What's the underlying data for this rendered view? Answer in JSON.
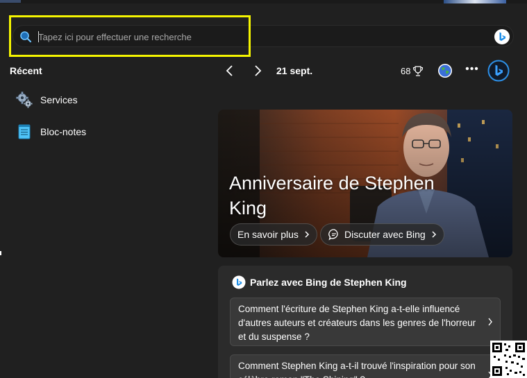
{
  "search": {
    "placeholder": "Tapez ici pour effectuer une recherche"
  },
  "recent": {
    "title": "Récent",
    "items": [
      {
        "label": "Services",
        "icon": "gear-icon"
      },
      {
        "label": "Bloc-notes",
        "icon": "notepad-icon"
      }
    ]
  },
  "header": {
    "date": "21 sept.",
    "points": "68"
  },
  "hero": {
    "title": "Anniversaire de Stephen King",
    "learn_more": "En savoir plus",
    "chat_bing": "Discuter avec Bing"
  },
  "bing_card": {
    "title": "Parlez avec Bing de Stephen King",
    "questions": [
      "Comment l'écriture de Stephen King a-t-elle influencé d'autres auteurs et créateurs dans les genres de l'horreur et du suspense ?",
      "Comment Stephen King a-t-il trouvé l'inspiration pour son célèbre roman \"The Shining\" ?"
    ]
  },
  "colors": {
    "background": "#202020",
    "highlight": "#f5f500",
    "bing_blue": "#1e8fe8",
    "card": "#2b2b2b"
  }
}
